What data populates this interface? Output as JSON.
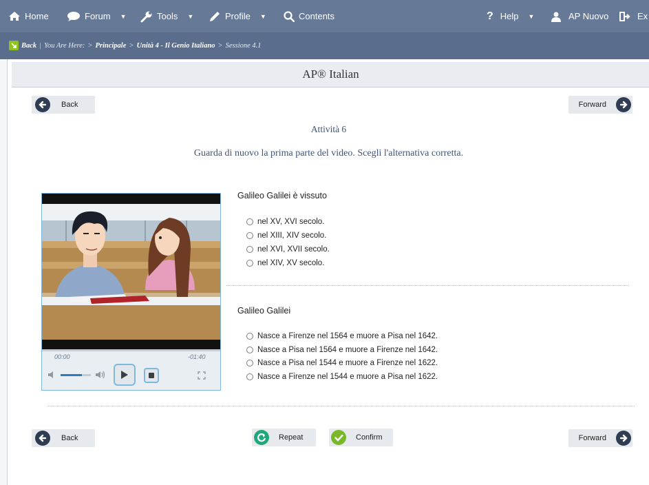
{
  "nav": {
    "home": "Home",
    "forum": "Forum",
    "tools": "Tools",
    "profile": "Profile",
    "contents": "Contents",
    "help": "Help",
    "user": "AP Nuovo",
    "exit": "Ex"
  },
  "breadcrumb": {
    "back": "Back",
    "sep": "|",
    "you_are_here": "You Are Here:",
    "arrow": ">",
    "items": [
      "Principale",
      "Unità 4 - Il Genio Italiano",
      "Sessione 4.1"
    ]
  },
  "course_title": "AP® Italian",
  "buttons": {
    "back": "Back",
    "forward": "Forward",
    "repeat": "Repeat",
    "confirm": "Confirm"
  },
  "activity": {
    "title": "Attività 6",
    "instructions": "Guarda di nuovo la prima parte del video. Scegli l'alternativa corretta."
  },
  "video": {
    "elapsed": "00:00",
    "remaining": "-01:40",
    "volume_fraction": 0.7,
    "progress_fraction": 0
  },
  "questions": [
    {
      "prompt": "Galileo Galilei è vissuto",
      "options": [
        "nel XV, XVI secolo.",
        "nel XIII, XIV secolo.",
        "nel XVI, XVII secolo.",
        "nel XIV, XV secolo."
      ]
    },
    {
      "prompt": "Galileo Galilei",
      "options": [
        "Nasce a Firenze nel 1564 e muore a Pisa nel 1642.",
        "Nasce a Pisa nel 1564 e muore a Firenze nel 1642.",
        "Nasce a Pisa nel 1544 e muore a Firenze nel 1622.",
        "Nasce a Firenze nel 1544 e muore a Pisa nel 1622."
      ]
    }
  ],
  "colors": {
    "nav_bg": "#667a98",
    "crumb_bg": "#5a6d8c",
    "text_blue": "#3c557a",
    "icon_dark": "#2e3d52",
    "repeat_green": "#1fa87a",
    "confirm_green": "#79b82a"
  }
}
